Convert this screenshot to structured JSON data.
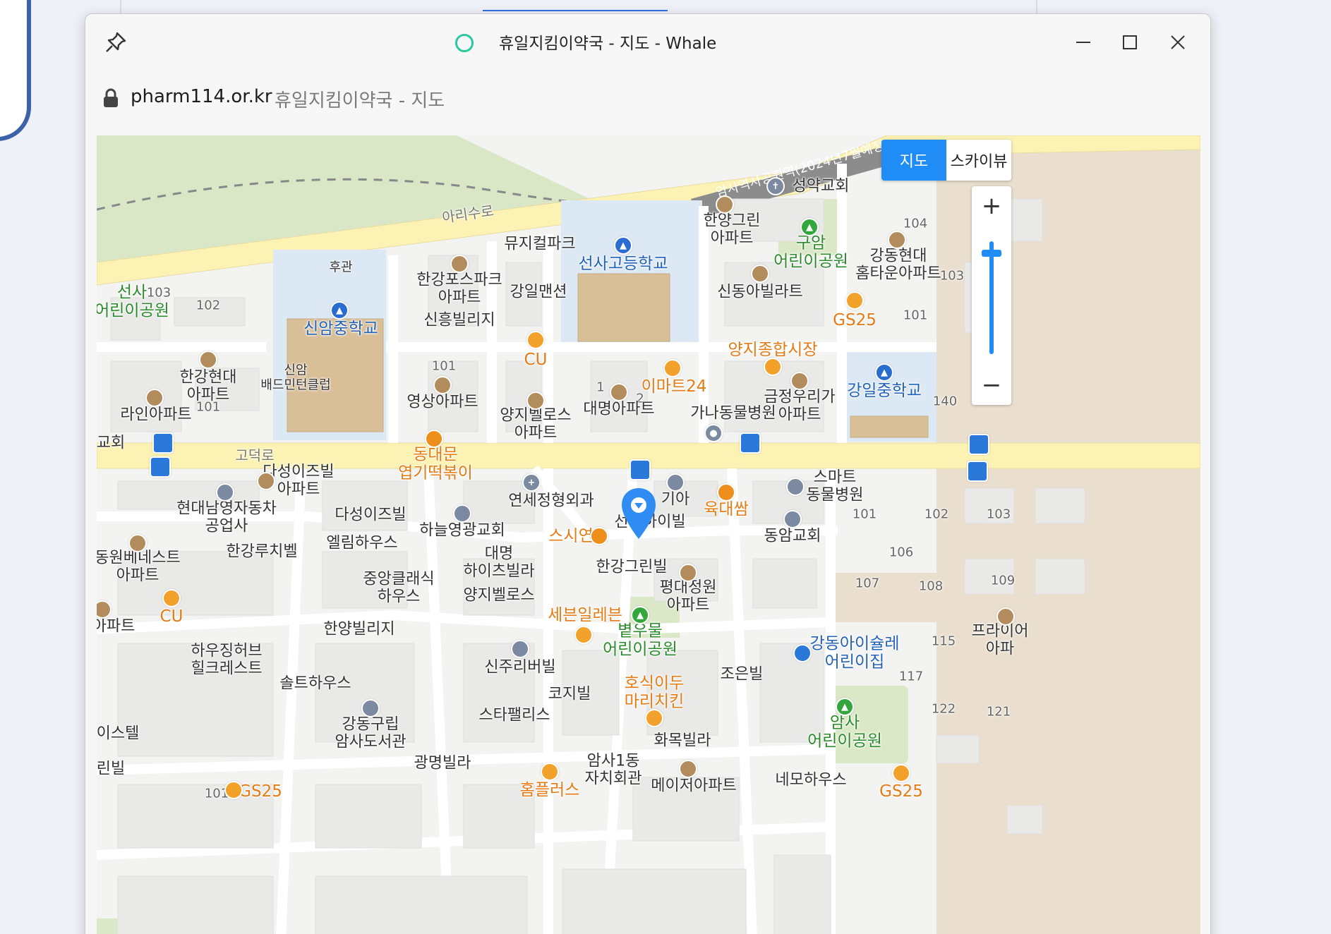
{
  "window": {
    "title": "휴일지킴이약국 - 지도 - Whale",
    "url_host": "pharm114.or.kr",
    "url_title": "휴일지킴이약국 - 지도"
  },
  "icons": {
    "pin": "pin-icon",
    "lock": "lock-icon",
    "minimize": "minimize-icon",
    "maximize": "maximize-icon",
    "close": "close-icon",
    "location": "location-pin-icon"
  },
  "colors": {
    "accent": "#1f8df5",
    "school_label": "#2262b7",
    "park_label": "#2b8a2b",
    "store_label": "#e47b14",
    "road_main": "#fbf2b4",
    "park_fill": "#dbe8c8",
    "school_fill": "#dce8f3",
    "rail": "#8a8a8a"
  },
  "controls": {
    "map_type": [
      "지도",
      "스카이뷰"
    ],
    "active_map_type": "지도",
    "zoom_in": "+",
    "zoom_out": "−",
    "zoom_level": 0.85
  },
  "roads": {
    "ariro": "아리수로",
    "godeokro": "고덕로",
    "station": "암사역사공원역(2024년7월예정)"
  },
  "labels": [
    {
      "text": "성약교회",
      "type": "normal"
    },
    {
      "text": "한양그린\n아파트",
      "type": "normal"
    },
    {
      "text": "구암\n어린이공원",
      "type": "park"
    },
    {
      "text": "104",
      "type": "num"
    },
    {
      "text": "강동현대\n홈타운아파트",
      "type": "normal"
    },
    {
      "text": "103",
      "type": "num"
    },
    {
      "text": "뮤지컬파크",
      "type": "normal"
    },
    {
      "text": "선사고등학교",
      "type": "school"
    },
    {
      "text": "후관",
      "type": "small"
    },
    {
      "text": "한강포스파크\n아파트",
      "type": "normal"
    },
    {
      "text": "강일맨션",
      "type": "normal"
    },
    {
      "text": "신동아빌라트",
      "type": "normal"
    },
    {
      "text": "GS25",
      "type": "store"
    },
    {
      "text": "101",
      "type": "num"
    },
    {
      "text": "선사\n어린이공원",
      "type": "park"
    },
    {
      "text": "103",
      "type": "num"
    },
    {
      "text": "102",
      "type": "num"
    },
    {
      "text": "신암중학교",
      "type": "school"
    },
    {
      "text": "신흥빌리지",
      "type": "normal"
    },
    {
      "text": "CU",
      "type": "store"
    },
    {
      "text": "양지종합시장",
      "type": "store"
    },
    {
      "text": "이마트24",
      "type": "store"
    },
    {
      "text": "강일중학교",
      "type": "school"
    },
    {
      "text": "한강현대\n아파트",
      "type": "normal"
    },
    {
      "text": "101",
      "type": "num"
    },
    {
      "text": "신암\n배드민턴클럽",
      "type": "small"
    },
    {
      "text": "101",
      "type": "num"
    },
    {
      "text": "영상아파트",
      "type": "normal"
    },
    {
      "text": "1",
      "type": "num"
    },
    {
      "text": "2",
      "type": "num"
    },
    {
      "text": "대명아파트",
      "type": "normal"
    },
    {
      "text": "금정우리가\n아파트",
      "type": "normal"
    },
    {
      "text": "140",
      "type": "num"
    },
    {
      "text": "라인아파트",
      "type": "normal"
    },
    {
      "text": "양지벨로스\n아파트",
      "type": "normal"
    },
    {
      "text": "가나동물병원",
      "type": "normal"
    },
    {
      "text": "교회",
      "type": "normal"
    },
    {
      "text": "고덕로",
      "type": "road"
    },
    {
      "text": "동대문\n엽기떡볶이",
      "type": "store"
    },
    {
      "text": "다성이즈빌\n아파트",
      "type": "normal"
    },
    {
      "text": "스마트\n동물병원",
      "type": "normal"
    },
    {
      "text": "연세정형외과",
      "type": "normal"
    },
    {
      "text": "기아",
      "type": "normal"
    },
    {
      "text": "육대쌈",
      "type": "store"
    },
    {
      "text": "현대남영자동차\n공업사",
      "type": "normal"
    },
    {
      "text": "다성이즈빌",
      "type": "normal"
    },
    {
      "text": "하늘영광교회",
      "type": "normal"
    },
    {
      "text": "선사하이빌",
      "type": "normal"
    },
    {
      "text": "101",
      "type": "num"
    },
    {
      "text": "102",
      "type": "num"
    },
    {
      "text": "103",
      "type": "num"
    },
    {
      "text": "동암교회",
      "type": "normal"
    },
    {
      "text": "스시연",
      "type": "store"
    },
    {
      "text": "엘림하우스",
      "type": "normal"
    },
    {
      "text": "한강루치벨",
      "type": "normal"
    },
    {
      "text": "대명\n하이츠빌라",
      "type": "normal"
    },
    {
      "text": "106",
      "type": "num"
    },
    {
      "text": "동원베네스트\n아파트",
      "type": "normal"
    },
    {
      "text": "한강그린빌",
      "type": "normal"
    },
    {
      "text": "중앙클래식\n하우스",
      "type": "normal"
    },
    {
      "text": "평대정원\n아파트",
      "type": "normal"
    },
    {
      "text": "107",
      "type": "num"
    },
    {
      "text": "108",
      "type": "num"
    },
    {
      "text": "109",
      "type": "num"
    },
    {
      "text": "양지벨로스",
      "type": "normal"
    },
    {
      "text": "CU",
      "type": "store"
    },
    {
      "text": "세븐일레븐",
      "type": "store"
    },
    {
      "text": "볕우물\n어린이공원",
      "type": "park"
    },
    {
      "text": "아파트",
      "type": "normal"
    },
    {
      "text": "한양빌리지",
      "type": "normal"
    },
    {
      "text": "프라이어\n아파",
      "type": "normal"
    },
    {
      "text": "115",
      "type": "num"
    },
    {
      "text": "강동아이슐레\n어린이집",
      "type": "school"
    },
    {
      "text": "하우징허브\n힐크레스트",
      "type": "normal"
    },
    {
      "text": "신주리버빌",
      "type": "normal"
    },
    {
      "text": "조은빌",
      "type": "normal"
    },
    {
      "text": "117",
      "type": "num"
    },
    {
      "text": "솔트하우스",
      "type": "normal"
    },
    {
      "text": "호식이두\n마리치킨",
      "type": "store"
    },
    {
      "text": "코지빌",
      "type": "normal"
    },
    {
      "text": "122",
      "type": "num"
    },
    {
      "text": "121",
      "type": "num"
    },
    {
      "text": "강동구립\n암사도서관",
      "type": "normal"
    },
    {
      "text": "스타팰리스",
      "type": "normal"
    },
    {
      "text": "암사\n어린이공원",
      "type": "park"
    },
    {
      "text": "이스텔",
      "type": "normal"
    },
    {
      "text": "화목빌라",
      "type": "normal"
    },
    {
      "text": "광명빌라",
      "type": "normal"
    },
    {
      "text": "암사1동\n자치회관",
      "type": "normal"
    },
    {
      "text": "린빌",
      "type": "normal"
    },
    {
      "text": "홈플러스",
      "type": "store"
    },
    {
      "text": "메이저아파트",
      "type": "normal"
    },
    {
      "text": "네모하우스",
      "type": "normal"
    },
    {
      "text": "GS25",
      "type": "store"
    },
    {
      "text": "GS25",
      "type": "store"
    },
    {
      "text": "101",
      "type": "num"
    }
  ]
}
